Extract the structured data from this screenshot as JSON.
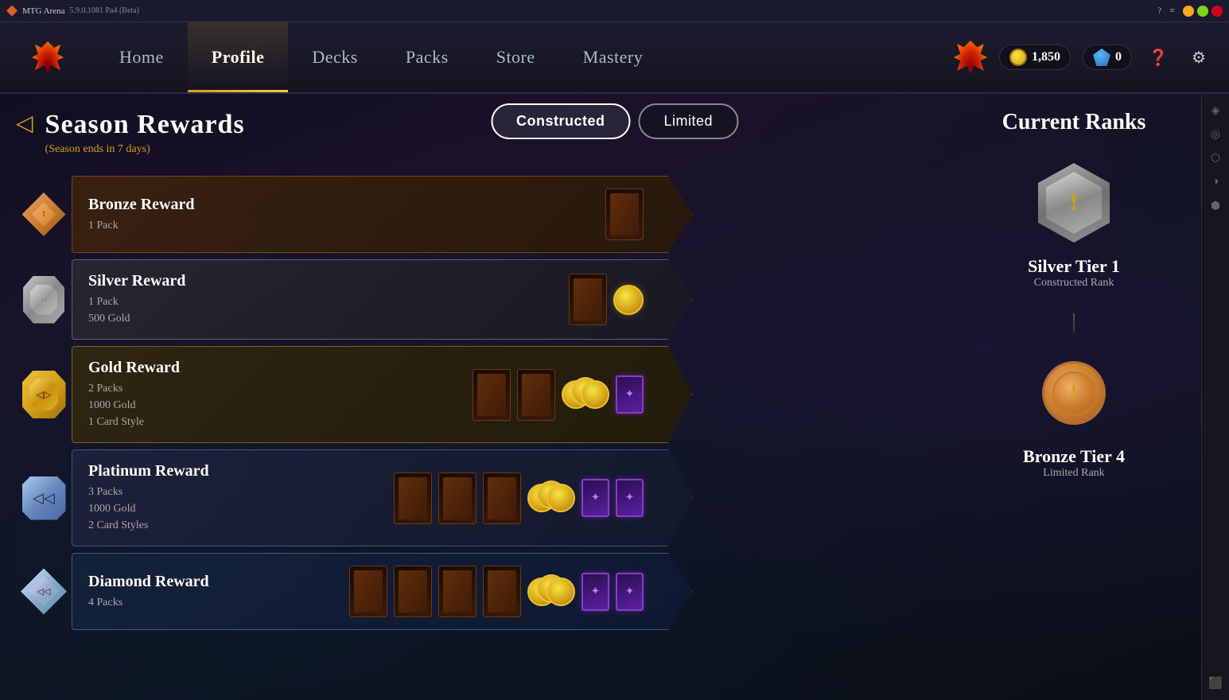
{
  "titlebar": {
    "app_name": "MTG Arena",
    "version": "5.9.0.1081 Pa4 (Beta)"
  },
  "navbar": {
    "items": [
      {
        "label": "Home",
        "active": false
      },
      {
        "label": "Profile",
        "active": true
      },
      {
        "label": "Decks",
        "active": false
      },
      {
        "label": "Packs",
        "active": false
      },
      {
        "label": "Store",
        "active": false
      },
      {
        "label": "Mastery",
        "active": false
      }
    ],
    "currency": {
      "gold": "1,850",
      "gems": "0"
    }
  },
  "page": {
    "title": "Season Rewards",
    "subtitle": "(Season ends in 7 days)",
    "tabs": [
      {
        "label": "Constructed",
        "active": true
      },
      {
        "label": "Limited",
        "active": false
      }
    ]
  },
  "rewards": [
    {
      "rank": "Bronze",
      "name": "Bronze Reward",
      "details": "1 Pack",
      "items": [
        "pack"
      ]
    },
    {
      "rank": "Silver",
      "name": "Silver Reward",
      "details_line1": "1 Pack",
      "details_line2": "500 Gold",
      "items": [
        "pack",
        "gold"
      ]
    },
    {
      "rank": "Gold",
      "name": "Gold Reward",
      "details_line1": "2 Packs",
      "details_line2": "1000 Gold",
      "details_line3": "1 Card Style",
      "items": [
        "pack",
        "pack",
        "gold-stack",
        "card-style"
      ]
    },
    {
      "rank": "Platinum",
      "name": "Platinum Reward",
      "details_line1": "3 Packs",
      "details_line2": "1000 Gold",
      "details_line3": "2 Card Styles",
      "items": [
        "pack",
        "pack",
        "pack",
        "gold-stack",
        "card-style",
        "card-style"
      ]
    },
    {
      "rank": "Diamond",
      "name": "Diamond Reward",
      "details_line1": "4 Packs",
      "items": [
        "pack",
        "pack",
        "pack",
        "pack",
        "gold-stack",
        "card-style",
        "card-style"
      ]
    }
  ],
  "current_ranks": {
    "title": "Current Ranks",
    "constructed": {
      "name": "Silver Tier 1",
      "type": "Constructed Rank"
    },
    "limited": {
      "name": "Bronze Tier 4",
      "type": "Limited Rank"
    }
  },
  "right_sidebar": {
    "icons": [
      "⬜",
      "⚙",
      "◉",
      "◈",
      "◎",
      "⬡",
      "◑",
      "⬢"
    ]
  }
}
